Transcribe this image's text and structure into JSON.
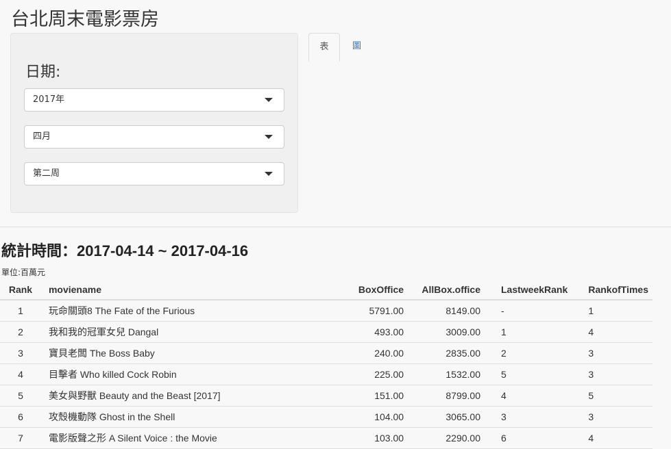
{
  "app": {
    "title": "台北周末電影票房"
  },
  "sidebar": {
    "label": "日期:",
    "year_select": "2017年",
    "month_select": "四月",
    "week_select": "第二周"
  },
  "tabs": [
    {
      "label": "表",
      "active": true
    },
    {
      "label": "圖",
      "active": false
    }
  ],
  "main": {
    "stat_title": "統計時間：2017-04-14 ~ 2017-04-16",
    "unit": "單位:百萬元"
  },
  "table": {
    "headers": [
      "Rank",
      "moviename",
      "BoxOffice",
      "AllBox.office",
      "LastweekRank",
      "RankofTimes"
    ],
    "rows": [
      [
        "1",
        "玩命關頭8 The Fate of the Furious",
        "5791.00",
        "8149.00",
        "-",
        "1"
      ],
      [
        "2",
        "我和我的冠軍女兒 Dangal",
        "493.00",
        "3009.00",
        "1",
        "4"
      ],
      [
        "3",
        "寶貝老闆 The Boss Baby",
        "240.00",
        "2835.00",
        "2",
        "3"
      ],
      [
        "4",
        "目擊者 Who killed Cock Robin",
        "225.00",
        "1532.00",
        "5",
        "3"
      ],
      [
        "5",
        "美女與野獸 Beauty and the Beast [2017]",
        "151.00",
        "8799.00",
        "4",
        "5"
      ],
      [
        "6",
        "攻殼機動隊 Ghost in the Shell",
        "104.00",
        "3065.00",
        "3",
        "3"
      ],
      [
        "7",
        "電影版聲之形 A Silent Voice : the Movie",
        "103.00",
        "2290.00",
        "6",
        "4"
      ]
    ]
  }
}
